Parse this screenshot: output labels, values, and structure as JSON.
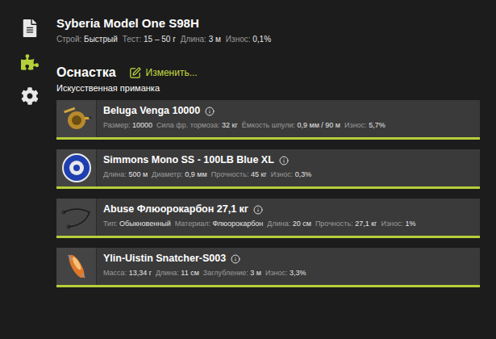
{
  "sidebar": {
    "items": [
      {
        "selected": false
      },
      {
        "selected": true
      },
      {
        "selected": false
      }
    ]
  },
  "rod": {
    "name": "Syberia Model One S98H",
    "stats": [
      {
        "label": "Строй:",
        "value": "Быстрый"
      },
      {
        "label": "Тест:",
        "value": "15 – 50 г"
      },
      {
        "label": "Длина:",
        "value": "3 м"
      },
      {
        "label": "Износ:",
        "value": "0,1%"
      }
    ]
  },
  "tackle": {
    "title": "Оснастка",
    "edit": "Изменить...",
    "bait_type": "Искусственная приманка",
    "items": [
      {
        "kind": "reel",
        "name": "Beluga Venga 10000",
        "stats": [
          {
            "label": "Размер:",
            "value": "10000"
          },
          {
            "label": "Сила фр. тормоза:",
            "value": "32 кг"
          },
          {
            "label": "Ёмкость шпули:",
            "value": "0,9 мм / 90 м"
          },
          {
            "label": "Износ:",
            "value": "5,7%"
          }
        ]
      },
      {
        "kind": "line",
        "name": "Simmons Mono SS - 100LB Blue XL",
        "stats": [
          {
            "label": "Длина:",
            "value": "500 м"
          },
          {
            "label": "Диаметр:",
            "value": "0,9 мм"
          },
          {
            "label": "Прочность:",
            "value": "45 кг"
          },
          {
            "label": "Износ:",
            "value": "0,3%"
          }
        ]
      },
      {
        "kind": "leader",
        "name": "Abuse Флюорокарбон 27,1 кг",
        "stats": [
          {
            "label": "Тип:",
            "value": "Обыкновенный"
          },
          {
            "label": "Материал:",
            "value": "Флюорокарбон"
          },
          {
            "label": "Длина:",
            "value": "20 см"
          },
          {
            "label": "Прочность:",
            "value": "27,1 кг"
          },
          {
            "label": "Износ:",
            "value": "1%"
          }
        ]
      },
      {
        "kind": "lure",
        "name": "Ylin-Uistin Snatcher-S003",
        "stats": [
          {
            "label": "Масса:",
            "value": "13,34 г"
          },
          {
            "label": "Длина:",
            "value": "11 см"
          },
          {
            "label": "Заглубление:",
            "value": "3 м"
          },
          {
            "label": "Износ:",
            "value": "3,3%"
          }
        ]
      }
    ]
  }
}
